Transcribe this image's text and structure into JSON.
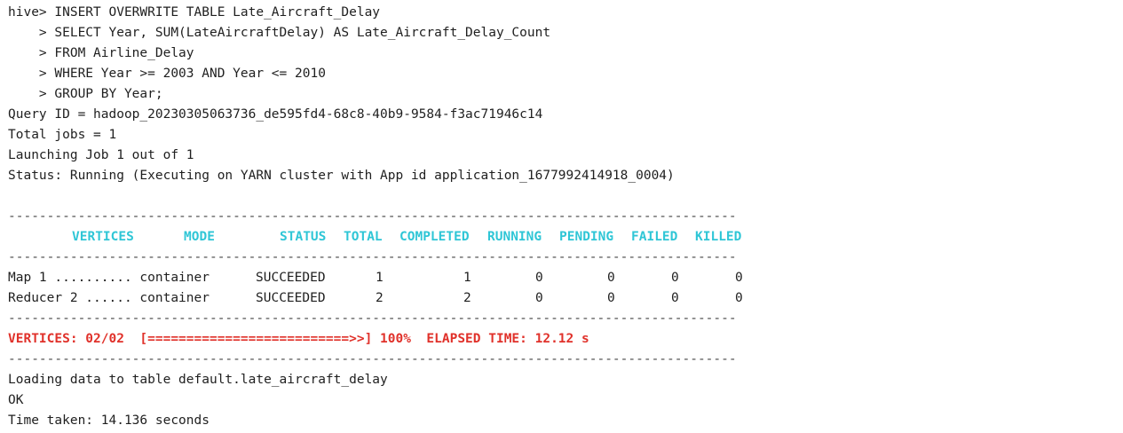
{
  "query_lines": [
    "hive> INSERT OVERWRITE TABLE Late_Aircraft_Delay",
    "    > SELECT Year, SUM(LateAircraftDelay) AS Late_Aircraft_Delay_Count",
    "    > FROM Airline_Delay",
    "    > WHERE Year >= 2003 AND Year <= 2010",
    "    > GROUP BY Year;"
  ],
  "job_info": {
    "query_id": "Query ID = hadoop_20230305063736_de595fd4-68c8-40b9-9584-f3ac71946c14",
    "total_jobs": "Total jobs = 1",
    "launching": "Launching Job 1 out of 1",
    "status": "Status: Running (Executing on YARN cluster with App id application_1677992414918_0004)"
  },
  "separator": "----------------------------------------------------------------------------------------------",
  "table": {
    "headers": {
      "vertices": "VERTICES",
      "mode": "MODE",
      "status": "STATUS",
      "total": "TOTAL",
      "completed": "COMPLETED",
      "running": "RUNNING",
      "pending": "PENDING",
      "failed": "FAILED",
      "killed": "KILLED"
    },
    "rows": [
      {
        "vertex": "Map 1 .......... container",
        "status": "SUCCEEDED",
        "total": "1",
        "completed": "1",
        "running": "0",
        "pending": "0",
        "failed": "0",
        "killed": "0"
      },
      {
        "vertex": "Reducer 2 ...... container",
        "status": "SUCCEEDED",
        "total": "2",
        "completed": "2",
        "running": "0",
        "pending": "0",
        "failed": "0",
        "killed": "0"
      }
    ]
  },
  "progress_line": "VERTICES: 02/02  [==========================>>] 100%  ELAPSED TIME: 12.12 s",
  "result_lines": [
    "Loading data to table default.late_aircraft_delay",
    "OK",
    "Time taken: 14.136 seconds"
  ],
  "colors": {
    "header_cyan": "#2fc6d6",
    "progress_red": "#e0312a",
    "text": "#1f1f1f"
  }
}
